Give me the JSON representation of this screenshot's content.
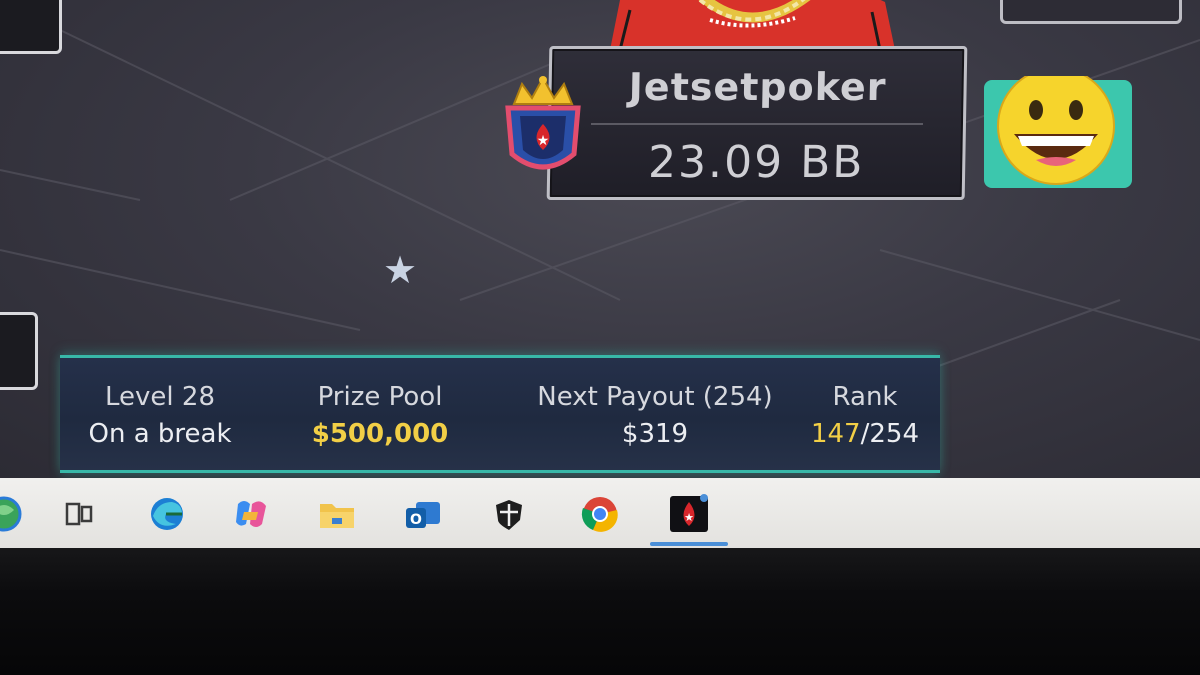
{
  "player": {
    "name": "Jetsetpoker",
    "stack": "23.09 BB"
  },
  "tournament_info": {
    "level_label": "Level 28",
    "level_status": "On a break",
    "prize_pool_label": "Prize Pool",
    "prize_pool_value": "$500,000",
    "next_payout_label": "Next Payout (254)",
    "next_payout_value": "$319",
    "rank_label": "Rank",
    "rank_current": "147",
    "rank_separator": "/",
    "rank_total": "254"
  },
  "colors": {
    "accent_teal": "#38b8a8",
    "highlight_gold": "#f2cf46",
    "taskbar_active": "#4a8fd8"
  },
  "taskbar": {
    "icons": [
      "start-icon",
      "task-view-icon",
      "edge-icon",
      "copilot-icon",
      "file-explorer-icon",
      "outlook-icon",
      "security-shield-icon",
      "chrome-icon",
      "pokerstars-icon"
    ],
    "active_app": "pokerstars-icon"
  }
}
